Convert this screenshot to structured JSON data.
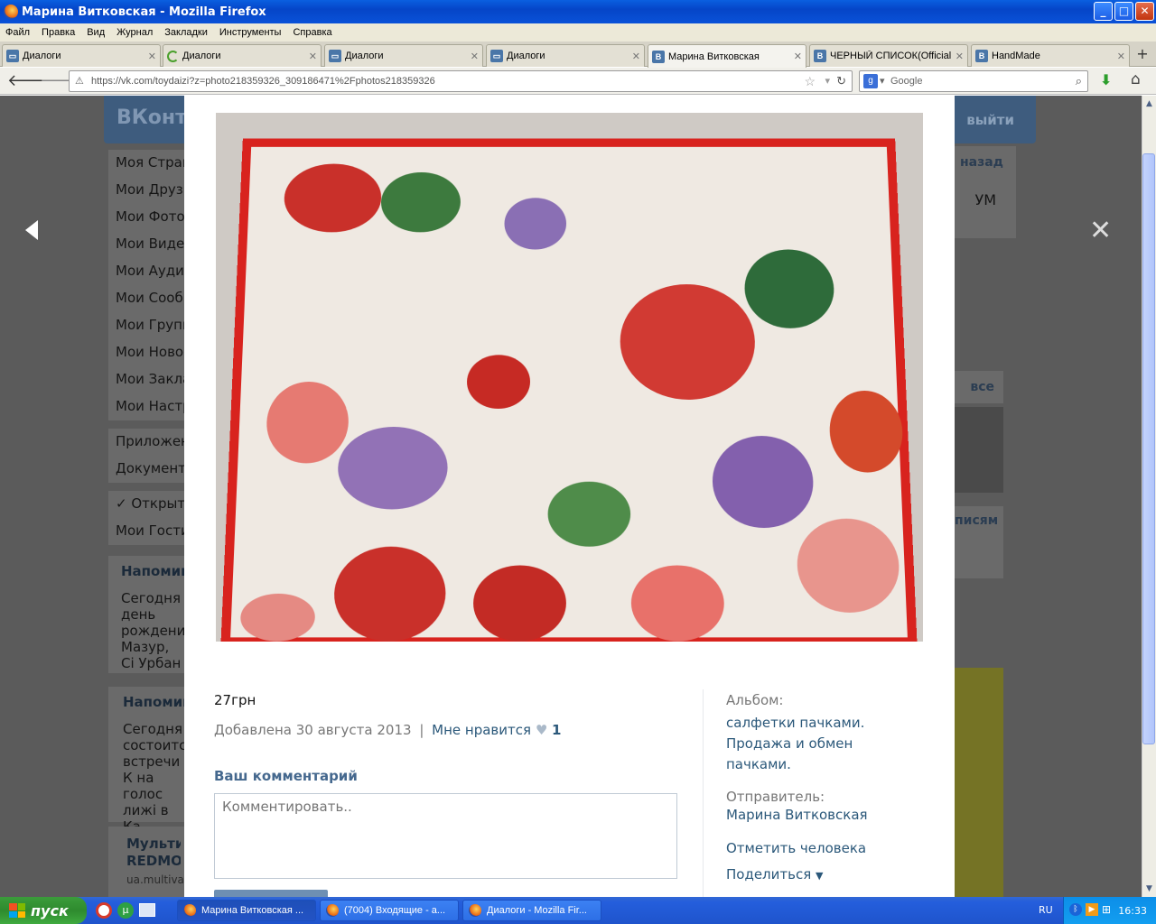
{
  "window": {
    "title": "Марина Витковская - Mozilla Firefox",
    "minimize": "_",
    "maximize": "□",
    "close": "✕"
  },
  "menu": [
    "Файл",
    "Правка",
    "Вид",
    "Журнал",
    "Закладки",
    "Инструменты",
    "Справка"
  ],
  "tabs": [
    {
      "label": "Диалоги",
      "icon": "dialog-icon"
    },
    {
      "label": "Диалоги",
      "icon": "loading-spinner-icon"
    },
    {
      "label": "Диалоги",
      "icon": "dialog-icon"
    },
    {
      "label": "Диалоги",
      "icon": "dialog-icon"
    },
    {
      "label": "Марина Витковская",
      "icon": "vk-icon",
      "active": true
    },
    {
      "label": "ЧЕРНЫЙ СПИСОК(Official...",
      "icon": "vk-icon"
    },
    {
      "label": "HandMade",
      "icon": "vk-icon"
    }
  ],
  "navigation": {
    "url": "https://vk.com/toydaizi?z=photo218359326_309186471%2Fphotos218359326",
    "search_placeholder": "Google"
  },
  "vk_background": {
    "logo": "ВКонтакте",
    "logout": "выйти",
    "back": "назад",
    "menu": [
      "Моя Страница",
      "Мои Друзья",
      "Мои Фотографии",
      "Мои Видеозаписи",
      "Мои Аудиозаписи",
      "Мои Сообщения",
      "Мои Группы",
      "Мои Новости",
      "Мои Закладки",
      "Мои Настройки",
      "Приложения",
      "Документы",
      "✓ Открыть",
      "Мои Гости"
    ],
    "reminder1_title": "Напоминание",
    "reminder1_text": "Сегодня день рождения Мазур, Сі Урбан",
    "reminder2_title": "Напоминание",
    "reminder2_text": "Сегодня состоится встречи К на голос лижі в Ка",
    "ad_title": "Мульти REDMO",
    "ad_url": "ua.multiva",
    "right_um": "УМ",
    "right_all": "все",
    "right_posts": "писям"
  },
  "photo_viewer": {
    "caption": "27грн",
    "added": "Добавлена 30 августа 2013",
    "separator": "|",
    "like_label": "Мне нравится",
    "like_count": "1",
    "comment_label": "Ваш комментарий",
    "comment_placeholder": "Комментировать..",
    "album_label": "Альбом:",
    "album_name": "салфетки пачками. Продажа и обмен пачками.",
    "sender_label": "Отправитель:",
    "sender_name": "Марина Витковская",
    "tag_person": "Отметить человека",
    "share": "Поделиться"
  },
  "taskbar": {
    "start": "пуск",
    "tasks": [
      {
        "label": "Марина Витковская ...",
        "active": true
      },
      {
        "label": "(7004) Входящие - a..."
      },
      {
        "label": "Диалоги - Mozilla Fir..."
      }
    ],
    "lang": "RU",
    "clock": "16:33"
  },
  "colors": {
    "vk_blue": "#45688e",
    "link": "#2b587a",
    "napkin_border": "#d8231e"
  }
}
